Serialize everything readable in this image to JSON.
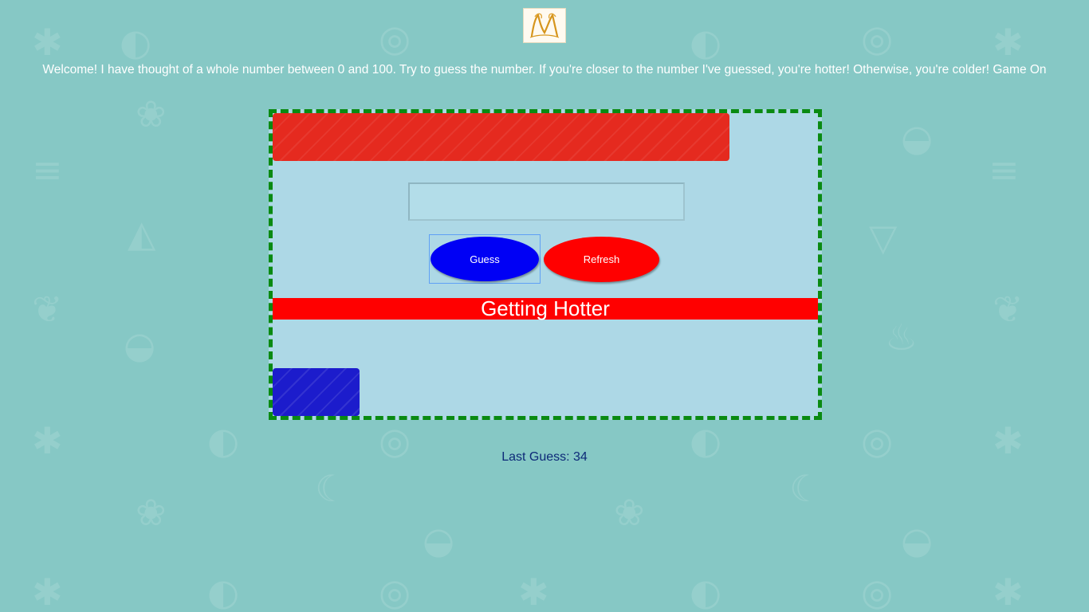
{
  "colors": {
    "background": "#86c8c5",
    "game_box": "#add8e6",
    "border": "#0a8a12",
    "hot_bar": "#e52a1f",
    "cold_bar": "#1c1ccc",
    "guess_button": "#0000f5",
    "refresh_button": "#ff0000",
    "status_bar": "#ff0000",
    "last_guess_text": "#0d2a78"
  },
  "header": {
    "logo_icon": "ornate-m-logo-icon",
    "intro_text": "Welcome! I have thought of a whole number between 0 and 100. Try to guess the number. If you're closer to the number I've guessed, you're hotter! Otherwise, you're colder! Game On"
  },
  "game": {
    "guess_input_value": "",
    "guess_input_placeholder": "",
    "guess_label": "Guess",
    "refresh_label": "Refresh",
    "status_text": "Getting Hotter"
  },
  "footer": {
    "last_guess_text": "Last Guess: 34"
  }
}
